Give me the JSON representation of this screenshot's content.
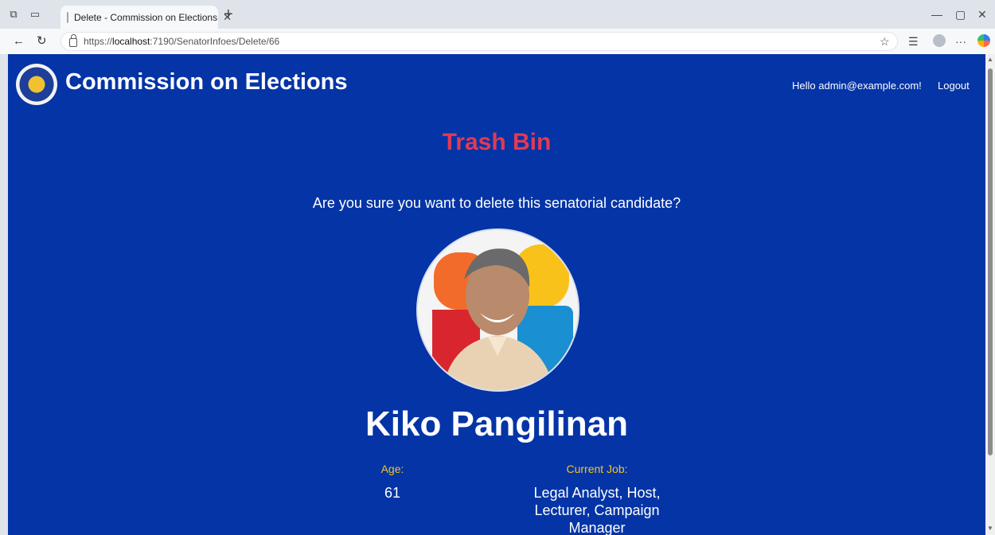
{
  "browser": {
    "tab_title": "Delete - Commission on Elections",
    "url_prefix": "https://",
    "url_host": "localhost",
    "url_rest": ":7190/SenatorInfoes/Delete/66"
  },
  "header": {
    "brand": "Commission on Elections",
    "greeting": "Hello admin@example.com!",
    "logout_label": "Logout"
  },
  "page": {
    "heading": "Trash Bin",
    "question": "Are you sure you want to delete this senatorial candidate?"
  },
  "candidate": {
    "name": "Kiko Pangilinan",
    "age_label": "Age:",
    "age_value": "61",
    "job_label": "Current Job:",
    "job_value": "Legal Analyst, Host, Lecturer, Campaign Manager"
  },
  "colors": {
    "page_background": "#0434a6",
    "heading": "#e23a55",
    "label": "#f5c518"
  }
}
